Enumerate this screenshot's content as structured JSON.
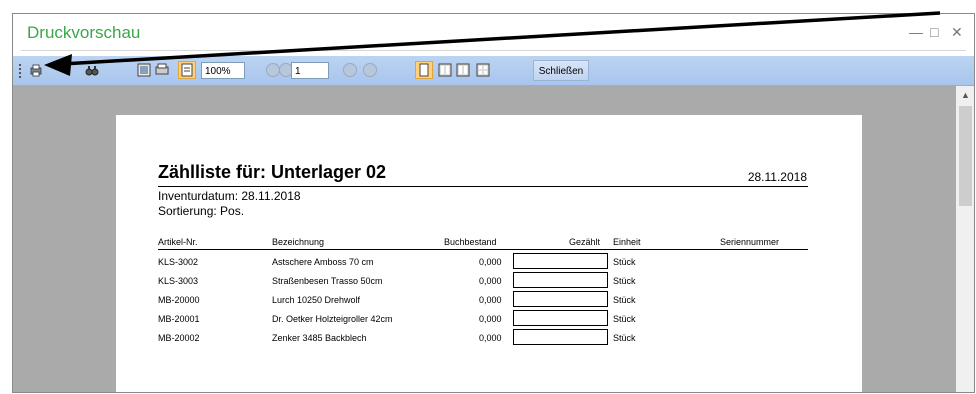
{
  "window": {
    "title": "Druckvorschau",
    "controls": {
      "minimize": "—",
      "maximize": "□",
      "close": "✕"
    }
  },
  "toolbar": {
    "zoom_value": "100%",
    "page_value": "1",
    "close_label": "Schließen"
  },
  "report": {
    "title": "Zählliste für: Unterlager 02",
    "date": "28.11.2018",
    "inventory_date_label": "Inventurdatum: 28.11.2018",
    "sort_label": "Sortierung: Pos.",
    "headers": {
      "article_no": "Artikel-Nr.",
      "description": "Bezeichnung",
      "stock": "Buchbestand",
      "counted": "Gezählt",
      "unit": "Einheit",
      "serial": "Seriennummer"
    },
    "rows": [
      {
        "article_no": "KLS-3002",
        "description": "Astschere Amboss 70 cm",
        "stock": "0,000",
        "unit": "Stück"
      },
      {
        "article_no": "KLS-3003",
        "description": "Straßenbesen Trasso 50cm",
        "stock": "0,000",
        "unit": "Stück"
      },
      {
        "article_no": "MB-20000",
        "description": "Lurch 10250 Drehwolf",
        "stock": "0,000",
        "unit": "Stück"
      },
      {
        "article_no": "MB-20001",
        "description": "Dr. Oetker Holzteigroller 42cm",
        "stock": "0,000",
        "unit": "Stück"
      },
      {
        "article_no": "MB-20002",
        "description": "Zenker 3485 Backblech",
        "stock": "0,000",
        "unit": "Stück"
      }
    ]
  },
  "icons": [
    "print-icon",
    "find-icon",
    "single-page-icon",
    "printer-setup-icon",
    "page-setup-icon",
    "first-page-icon",
    "previous-page-icon",
    "next-page-icon",
    "last-page-icon",
    "one-page-view-icon",
    "two-page-view-icon",
    "four-page-view-icon",
    "multi-page-view-icon"
  ],
  "colors": {
    "title": "#3aa84a",
    "toolbar": "#b5cef0",
    "preview_bg": "#aaaaaa"
  }
}
